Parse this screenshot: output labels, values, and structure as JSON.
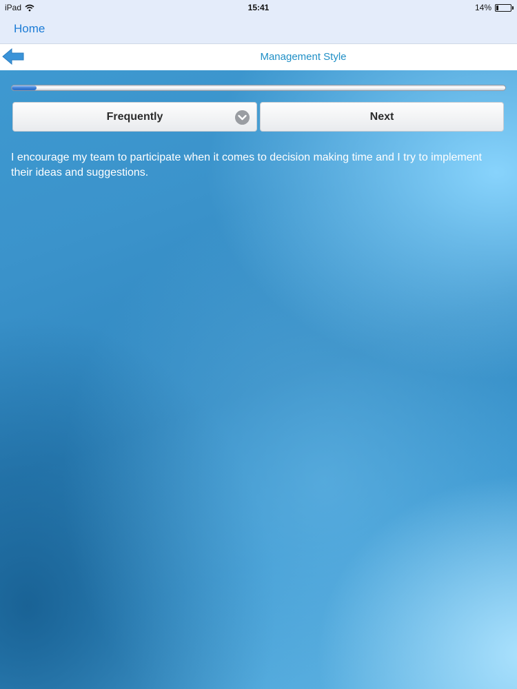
{
  "status_bar": {
    "device": "iPad",
    "time": "15:41",
    "battery": "14%",
    "battery_level": 0.14
  },
  "nav": {
    "home_label": "Home"
  },
  "title_bar": {
    "title": "Management Style",
    "back_icon": "back-arrow-icon"
  },
  "progress": {
    "value": 0.05
  },
  "answer_select": {
    "selected": "Frequently",
    "icon": "chevron-down-icon"
  },
  "next_button": {
    "label": "Next"
  },
  "question": {
    "text": "I encourage my team to participate when it comes to decision making time and I try to implement their ideas and suggestions."
  },
  "colors": {
    "accent": "#1c7cd6",
    "title": "#1f8fc6",
    "background": "#2f86bf"
  }
}
